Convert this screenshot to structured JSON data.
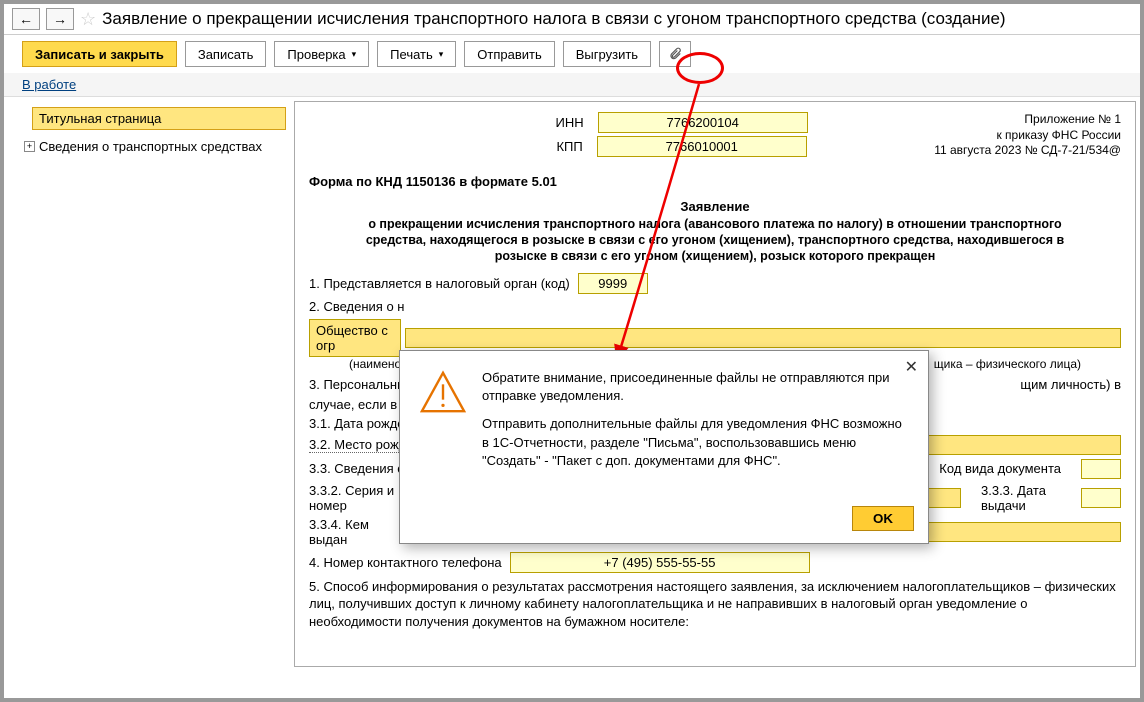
{
  "title": "Заявление о прекращении исчисления транспортного налога в связи с угоном транспортного средства (создание)",
  "toolbar": {
    "save_close": "Записать и закрыть",
    "save": "Записать",
    "check": "Проверка",
    "print": "Печать",
    "send": "Отправить",
    "export": "Выгрузить"
  },
  "status": "В работе",
  "sidebar": {
    "title_page": "Титульная страница",
    "vehicles": "Сведения о транспортных средствах"
  },
  "form": {
    "inn_label": "ИНН",
    "inn": "7766200104",
    "kpp_label": "КПП",
    "kpp": "7766010001",
    "appendix": "Приложение № 1",
    "order": "к приказу ФНС России",
    "date_order": "11 августа 2023 № СД-7-21/534@",
    "form_code": "Форма по КНД 1150136 в формате 5.01",
    "decl_title": "Заявление",
    "decl_body": "о прекращении исчисления транспортного налога (авансового платежа по налогу) в отношении транспортного средства, находящегося в розыске в связи с его угоном (хищением), транспортного средства, находившегося в розыске в связи с его угоном (хищением), розыск которого прекращен",
    "row1_label": "1. Представляется в налоговый орган (код)",
    "row1_value": "9999",
    "row2_label": "2. Сведения о н",
    "row2_org_full": "Общество с огр",
    "row2_sub": "(наименовани",
    "row2_sub_right": "щика – физического лица)",
    "row3_label": "3. Персональны",
    "row3_right": "щим личность) в",
    "row3_cont": "случае, если в на",
    "row31": "3.1. Дата рожде",
    "row32": "3.2. Место рожде",
    "row33": "3.3. Сведения о",
    "row33_doc": "Код вида документа",
    "row332": "3.3.2. Серия и номер",
    "row333": "3.3.3. Дата выдачи",
    "row334": "3.3.4. Кем выдан",
    "row4_label": "4. Номер контактного телефона",
    "row4_value": "+7 (495) 555-55-55",
    "row5": "5. Способ информирования о результатах рассмотрения настоящего заявления, за исключением налогоплательщиков – физических лиц, получивших доступ к личному кабинету налогоплательщика и не направивших в налоговый орган уведомление о необходимости получения документов на бумажном носителе:"
  },
  "dialog": {
    "p1": "Обратите внимание, присоединенные файлы не отправляются при отправке уведомления.",
    "p2": "Отправить дополнительные файлы для уведомления ФНС возможно в 1С-Отчетности, разделе \"Письма\", воспользовавшись меню \"Создать\" - \"Пакет с доп. документами для ФНС\".",
    "ok": "OK"
  }
}
